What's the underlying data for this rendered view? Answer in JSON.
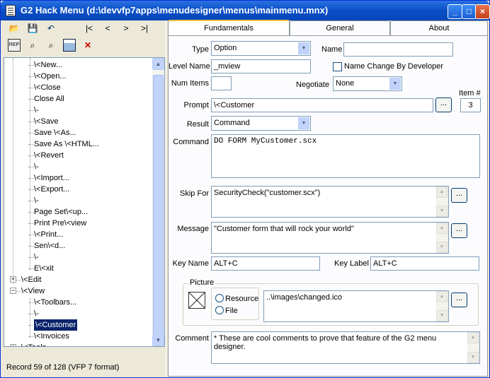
{
  "window": {
    "title": "G2 Hack Menu (d:\\devvfp7apps\\menudesigner\\menus\\mainmenu.mnx)"
  },
  "toolbar": {
    "row1": [
      "open-icon",
      "save-icon",
      "undo-icon",
      "|<",
      "<",
      ">",
      ">|"
    ],
    "nav_first": "|<",
    "nav_prev": "<",
    "nav_next": ">",
    "nav_last": ">|"
  },
  "tree": {
    "items": [
      {
        "label": "\\<New..."
      },
      {
        "label": "\\<Open..."
      },
      {
        "label": "\\<Close"
      },
      {
        "label": "Close All"
      },
      {
        "label": "\\-"
      },
      {
        "label": "\\<Save"
      },
      {
        "label": "Save \\<As..."
      },
      {
        "label": "Save As \\<HTML..."
      },
      {
        "label": "\\<Revert"
      },
      {
        "label": "\\-"
      },
      {
        "label": "\\<Import..."
      },
      {
        "label": "\\<Export..."
      },
      {
        "label": "\\-"
      },
      {
        "label": "Page Set\\<up..."
      },
      {
        "label": "Print Pre\\<view"
      },
      {
        "label": "\\<Print..."
      },
      {
        "label": "Sen\\<d..."
      },
      {
        "label": "\\-"
      },
      {
        "label": "E\\<xit"
      },
      {
        "label": "\\<Edit"
      },
      {
        "label": "\\<View"
      },
      {
        "label": "\\<Toolbars..."
      },
      {
        "label": "\\-"
      },
      {
        "label": "\\<Customer"
      },
      {
        "label": "\\<Invoices"
      },
      {
        "label": "\\<Tools"
      }
    ]
  },
  "status": "Record 59 of 128 (VFP 7 format)",
  "tabs": [
    "Fundamentals",
    "General",
    "About"
  ],
  "form": {
    "type_label": "Type",
    "type_value": "Option",
    "name_label": "Name",
    "name_value": "",
    "level_label": "Level Name",
    "level_value": "_mview",
    "name_change_label": "Name Change By Developer",
    "num_items_label": "Num Items",
    "num_items_value": "",
    "negotiate_label": "Negotiate",
    "negotiate_value": "None",
    "item_num_label": "Item #",
    "item_num_value": "3",
    "prompt_label": "Prompt",
    "prompt_value": "\\<Customer",
    "result_label": "Result",
    "result_value": "Command",
    "command_label": "Command",
    "command_value": "DO FORM MyCustomer.scx",
    "skip_label": "Skip For",
    "skip_value": "SecurityCheck(\"customer.scx\")",
    "message_label": "Message",
    "message_value": "\"Customer form that will rock your world\"",
    "keyname_label": "Key Name",
    "keyname_value": "ALT+C",
    "keylabel_label": "Key Label",
    "keylabel_value": "ALT+C",
    "picture_label": "Picture",
    "resource_label": "Resource",
    "file_label": "File",
    "picture_value": "..\\images\\changed.ico",
    "comment_label": "Comment",
    "comment_value": "* These are cool comments to prove that feature of the G2 menu designer.",
    "ellipsis": "..."
  }
}
